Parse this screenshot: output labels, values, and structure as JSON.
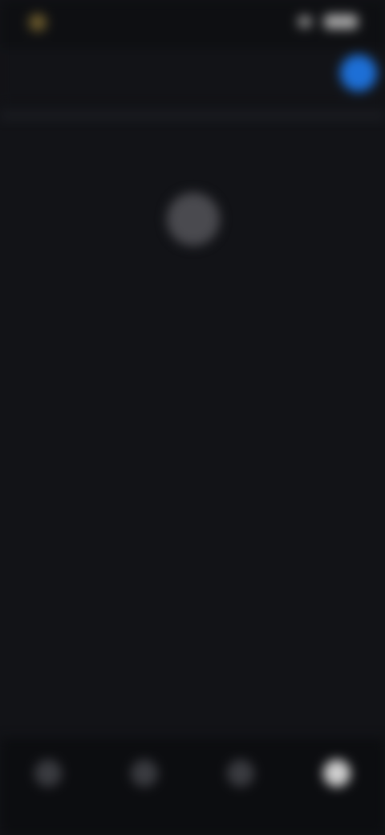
{
  "status_bar": {
    "time": "",
    "battery": ""
  },
  "header": {
    "title": ""
  },
  "empty_state": {
    "title": "",
    "description": ""
  },
  "bottom_nav": {
    "items": [
      {
        "label": "",
        "icon": "home-icon",
        "active": false
      },
      {
        "label": "",
        "icon": "search-icon",
        "active": false
      },
      {
        "label": "",
        "icon": "library-icon",
        "active": false
      },
      {
        "label": "",
        "icon": "profile-icon",
        "active": true
      }
    ]
  },
  "colors": {
    "background": "#121317",
    "accent": "#1d6fd6"
  }
}
